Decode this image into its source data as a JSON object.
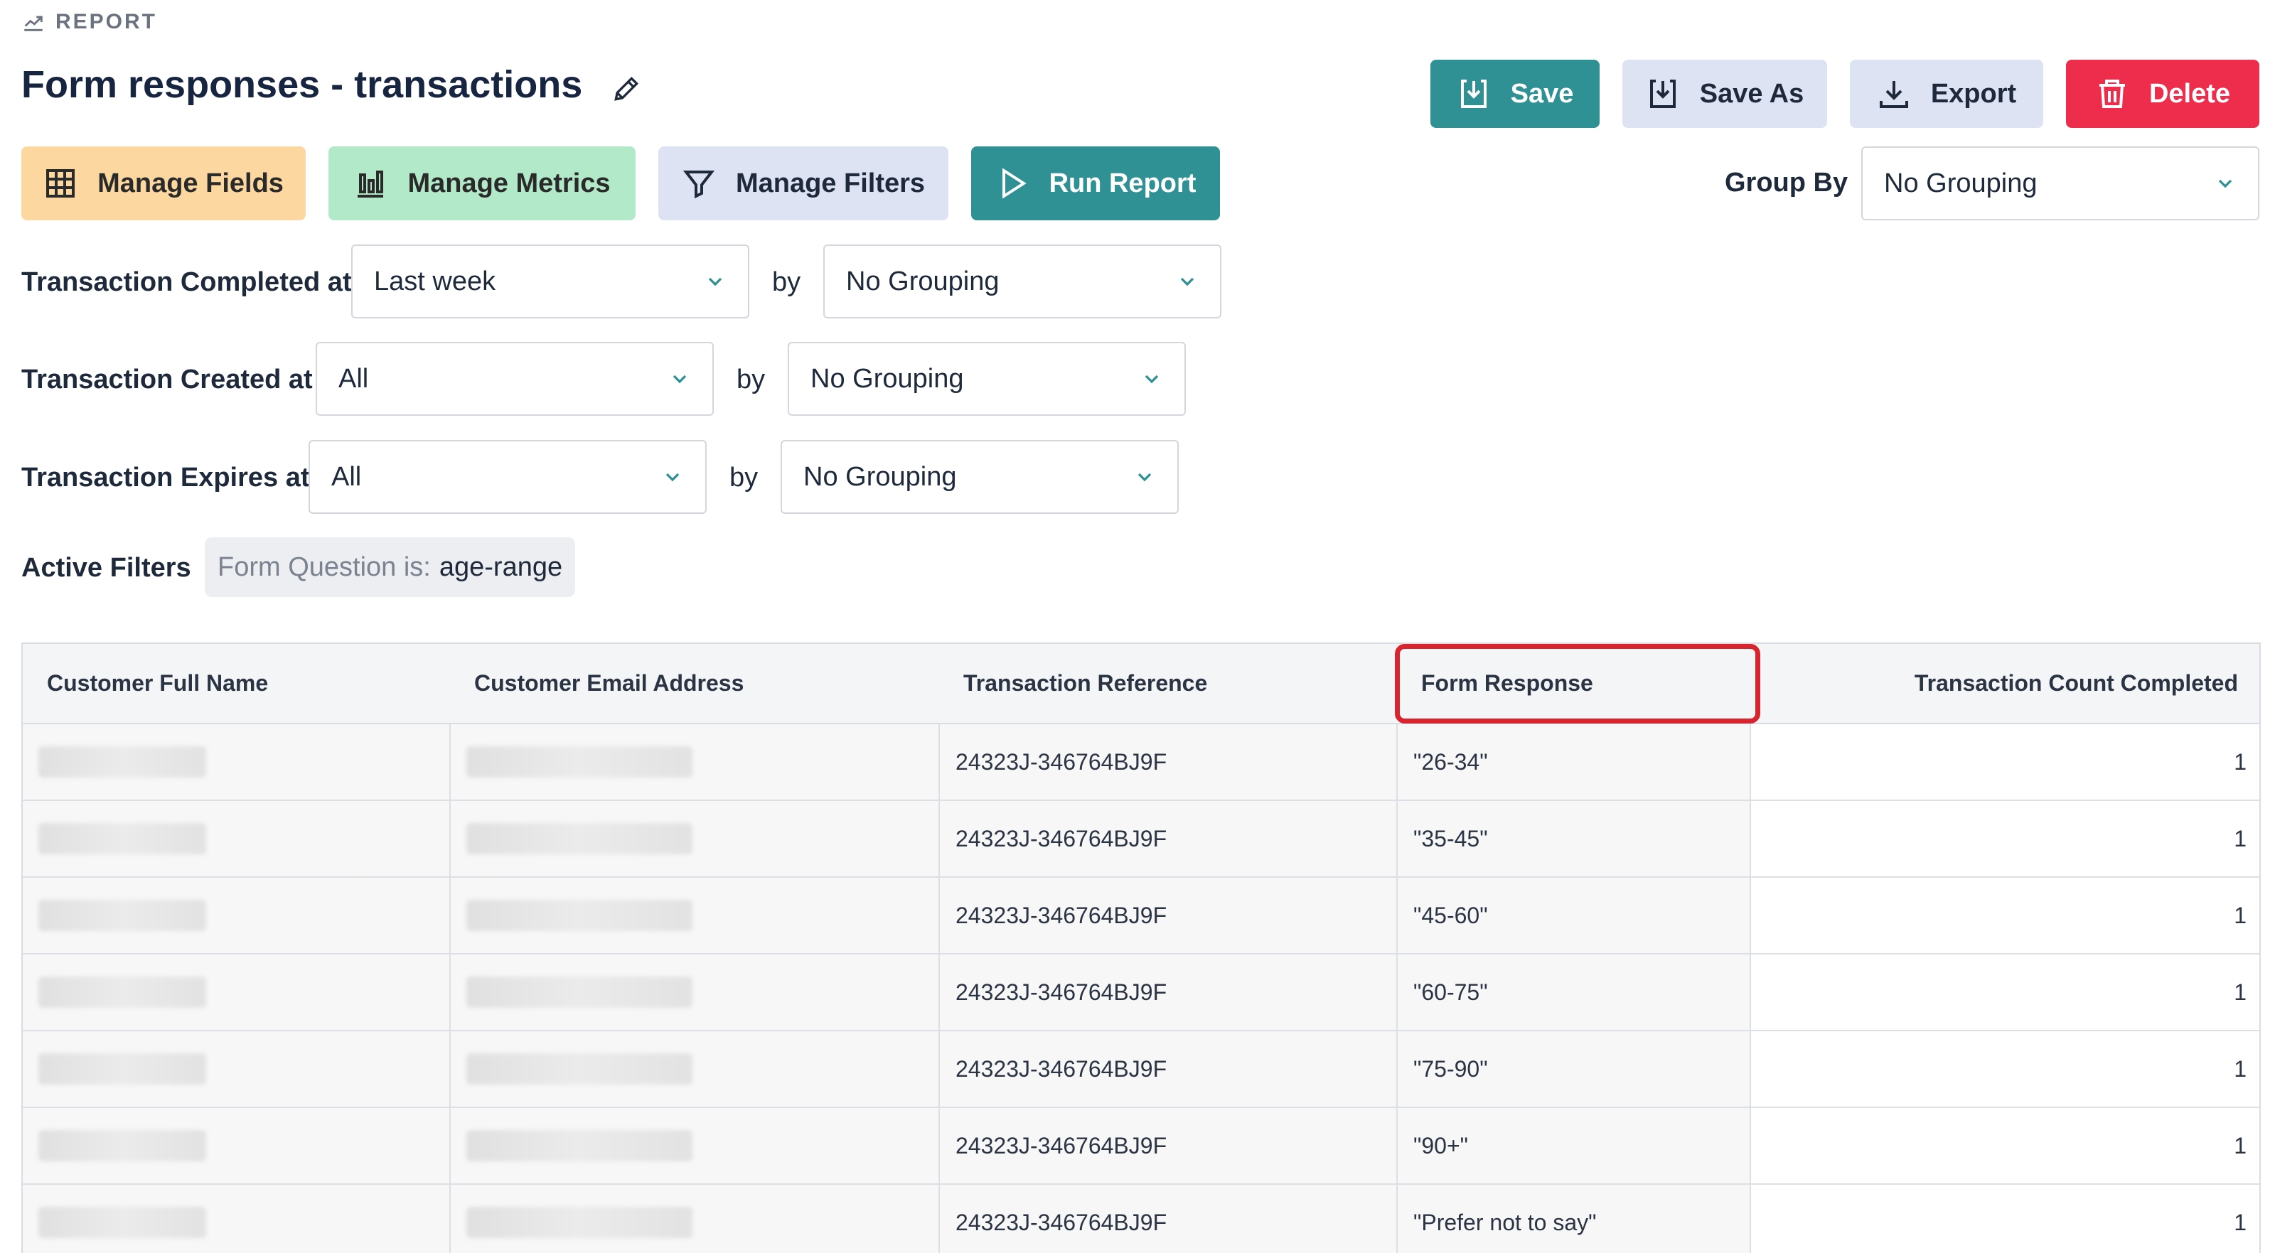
{
  "section": {
    "label": "REPORT",
    "icon": "trend-chart-icon"
  },
  "title": "Form responses - transactions",
  "toolbar": {
    "save": "Save",
    "save_as": "Save As",
    "export": "Export",
    "delete": "Delete"
  },
  "actions": {
    "manage_fields": "Manage Fields",
    "manage_metrics": "Manage Metrics",
    "manage_filters": "Manage Filters",
    "run_report": "Run Report"
  },
  "group_by": {
    "label": "Group By",
    "value": "No Grouping"
  },
  "date_filters": [
    {
      "label": "Transaction Completed at",
      "range": "Last week",
      "by": "by",
      "grouping": "No Grouping"
    },
    {
      "label": "Transaction Created at",
      "range": "All",
      "by": "by",
      "grouping": "No Grouping"
    },
    {
      "label": "Transaction Expires at",
      "range": "All",
      "by": "by",
      "grouping": "No Grouping"
    }
  ],
  "active_filters": {
    "label": "Active Filters",
    "chip_key": "Form Question is:",
    "chip_value": "age-range"
  },
  "table": {
    "headers": [
      "Customer Full Name",
      "Customer Email Address",
      "Transaction Reference",
      "Form Response",
      "Transaction Count Completed"
    ],
    "rows": [
      {
        "reference": "24323J-346764BJ9F",
        "response": "\"26-34\"",
        "count": "1"
      },
      {
        "reference": "24323J-346764BJ9F",
        "response": "\"35-45\"",
        "count": "1"
      },
      {
        "reference": "24323J-346764BJ9F",
        "response": "\"45-60\"",
        "count": "1"
      },
      {
        "reference": "24323J-346764BJ9F",
        "response": "\"60-75\"",
        "count": "1"
      },
      {
        "reference": "24323J-346764BJ9F",
        "response": "\"75-90\"",
        "count": "1"
      },
      {
        "reference": "24323J-346764BJ9F",
        "response": "\"90+\"",
        "count": "1"
      },
      {
        "reference": "24323J-346764BJ9F",
        "response": "\"Prefer not to say\"",
        "count": "1"
      }
    ]
  },
  "colors": {
    "teal": "#2f9194",
    "red": "#ee2d4c",
    "highlight": "#d7242f",
    "amber": "#fcd8a0",
    "green": "#b2e9c8",
    "lavender": "#dde3f3"
  }
}
